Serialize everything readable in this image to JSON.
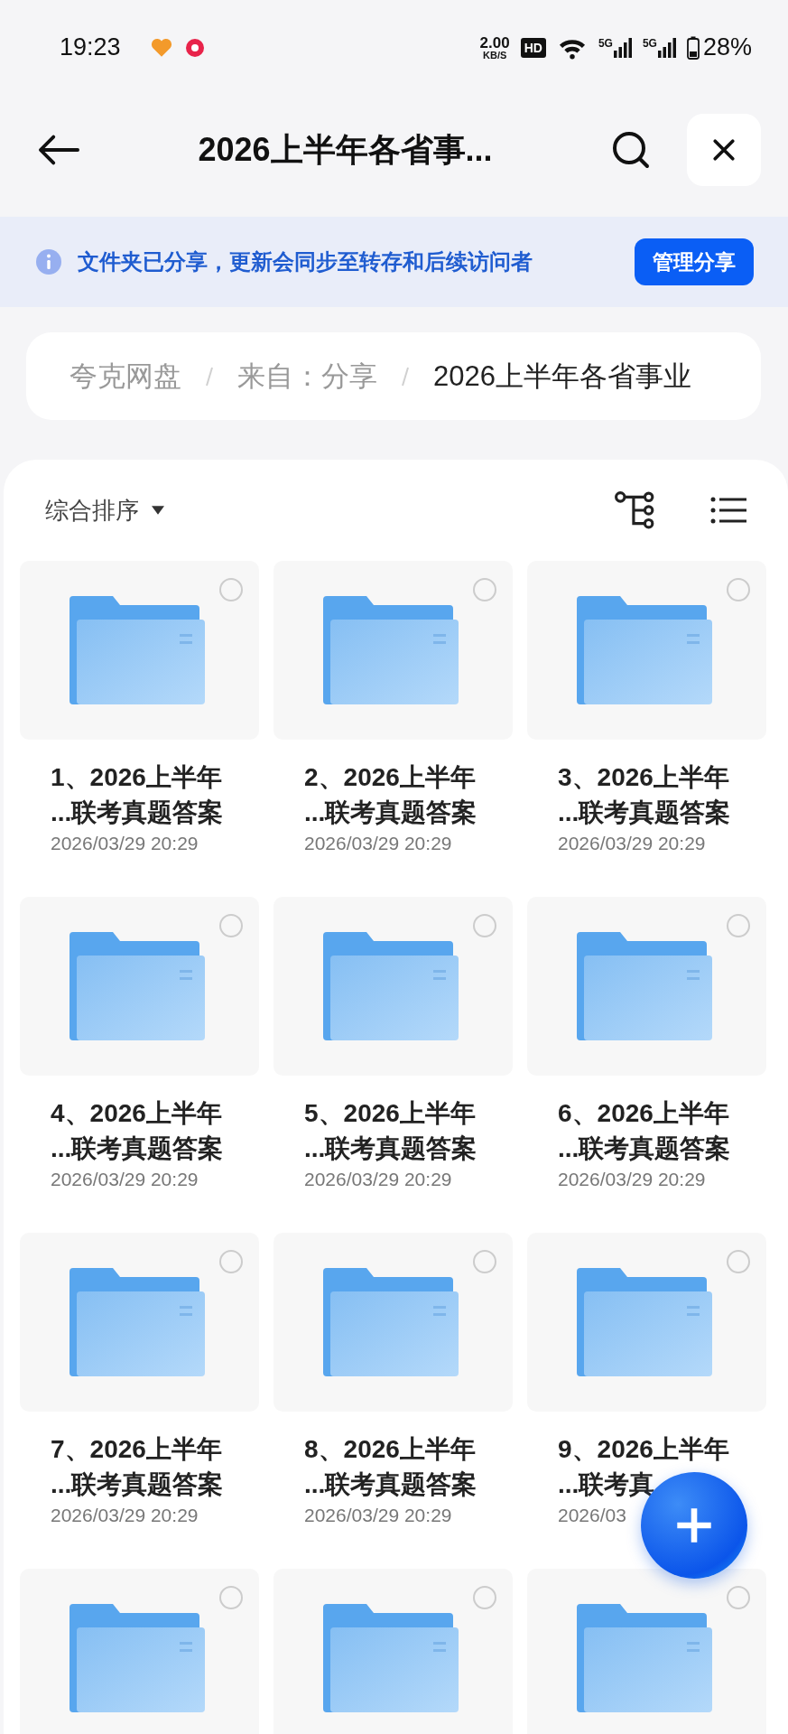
{
  "status_bar": {
    "time": "19:23",
    "net_speed": "2.00",
    "net_speed_unit": "KB/S",
    "hd_badge": "HD",
    "signals": [
      {
        "label": "5G"
      },
      {
        "label": "5G"
      }
    ],
    "battery": "28%"
  },
  "header": {
    "title": "2026上半年各省事..."
  },
  "share_notice": {
    "text": "文件夹已分享，更新会同步至转存和后续访问者",
    "button": "管理分享"
  },
  "breadcrumb": [
    {
      "label": "夸克网盘",
      "current": false
    },
    {
      "label": "来自：分享",
      "current": false
    },
    {
      "label": "2026上半年各省事业",
      "current": true
    }
  ],
  "sort": {
    "label": "综合排序"
  },
  "files": [
    {
      "title_lines": [
        "1、2026上半年",
        "...联考真题答案"
      ],
      "date": "2026/03/29 20:29",
      "selected": false
    },
    {
      "title_lines": [
        "2、2026上半年",
        "...联考真题答案"
      ],
      "date": "2026/03/29 20:29",
      "selected": false
    },
    {
      "title_lines": [
        "3、2026上半年",
        "...联考真题答案"
      ],
      "date": "2026/03/29 20:29",
      "selected": false
    },
    {
      "title_lines": [
        "4、2026上半年",
        "...联考真题答案"
      ],
      "date": "2026/03/29 20:29",
      "selected": false
    },
    {
      "title_lines": [
        "5、2026上半年",
        "...联考真题答案"
      ],
      "date": "2026/03/29 20:29",
      "selected": false
    },
    {
      "title_lines": [
        "6、2026上半年",
        "...联考真题答案"
      ],
      "date": "2026/03/29 20:29",
      "selected": false
    },
    {
      "title_lines": [
        "7、2026上半年",
        "...联考真题答案"
      ],
      "date": "2026/03/29 20:29",
      "selected": false
    },
    {
      "title_lines": [
        "8、2026上半年",
        "...联考真题答案"
      ],
      "date": "2026/03/29 20:29",
      "selected": false
    },
    {
      "title_lines": [
        "9、2026上半年",
        "...联考真"
      ],
      "date": "2026/03",
      "selected": false
    },
    {
      "selected": false
    },
    {
      "selected": false
    },
    {
      "selected": false
    }
  ]
}
